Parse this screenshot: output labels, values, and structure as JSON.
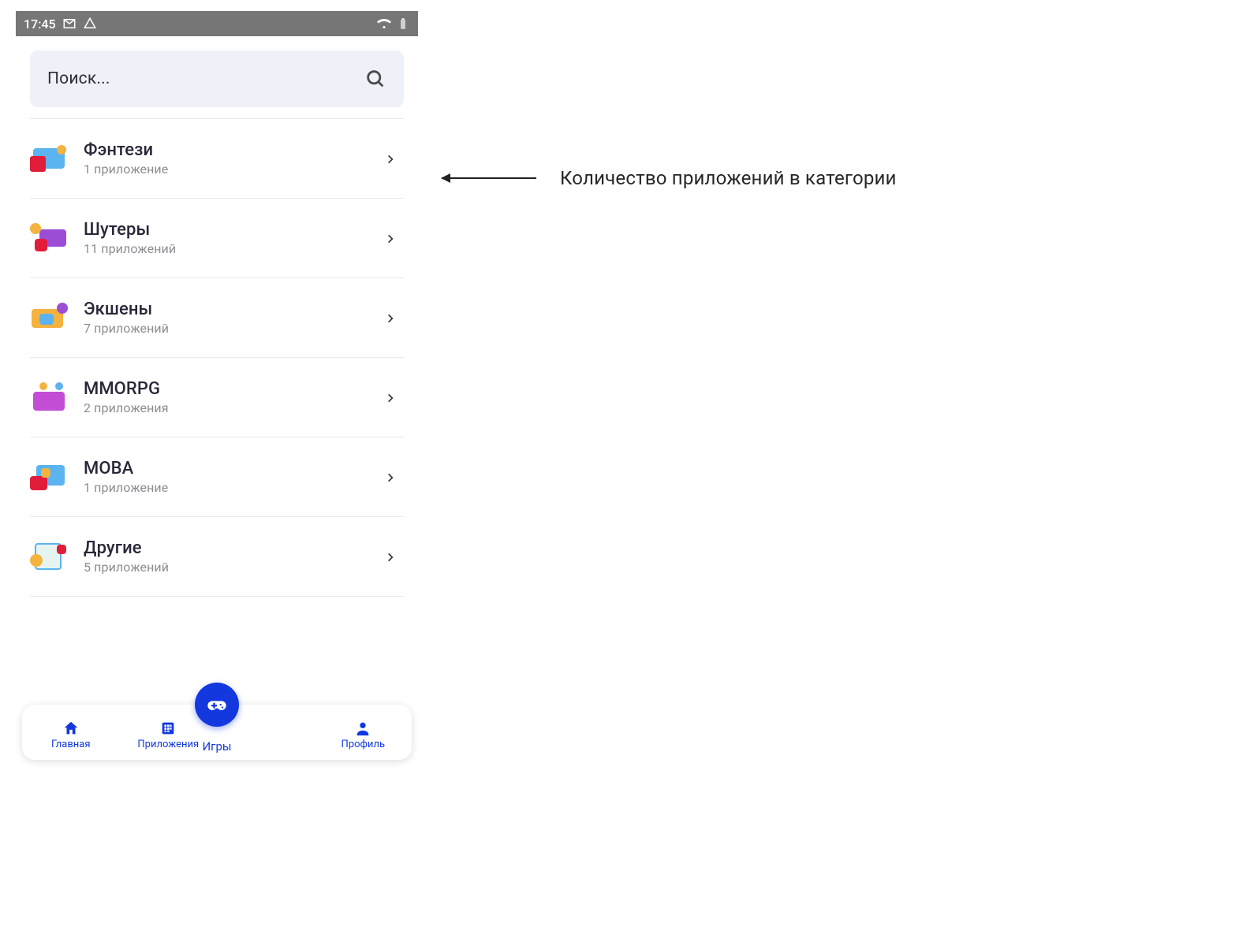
{
  "status": {
    "time": "17:45",
    "icons_left": [
      "gmail-icon",
      "drive-icon"
    ],
    "icons_right": [
      "wifi-icon",
      "battery-icon"
    ]
  },
  "search": {
    "placeholder": "Поиск..."
  },
  "categories": [
    {
      "title": "Фэнтези",
      "sub": "1 приложение",
      "icon": "fantasy-icon"
    },
    {
      "title": "Шутеры",
      "sub": "11 приложений",
      "icon": "shooters-icon"
    },
    {
      "title": "Экшены",
      "sub": "7 приложений",
      "icon": "action-icon"
    },
    {
      "title": "MMORPG",
      "sub": "2 приложения",
      "icon": "mmorpg-icon"
    },
    {
      "title": "MOBA",
      "sub": "1 приложение",
      "icon": "moba-icon"
    },
    {
      "title": "Другие",
      "sub": "5 приложений",
      "icon": "other-icon"
    }
  ],
  "nav": {
    "home": "Главная",
    "apps": "Приложения",
    "games": "Игры",
    "profile": "Профиль"
  },
  "annotation": "Количество приложений в категории",
  "colors": {
    "accent": "#1338e0",
    "search_bg": "#eef1f8",
    "statusbar": "#767676",
    "subtext": "#8c8c93"
  }
}
